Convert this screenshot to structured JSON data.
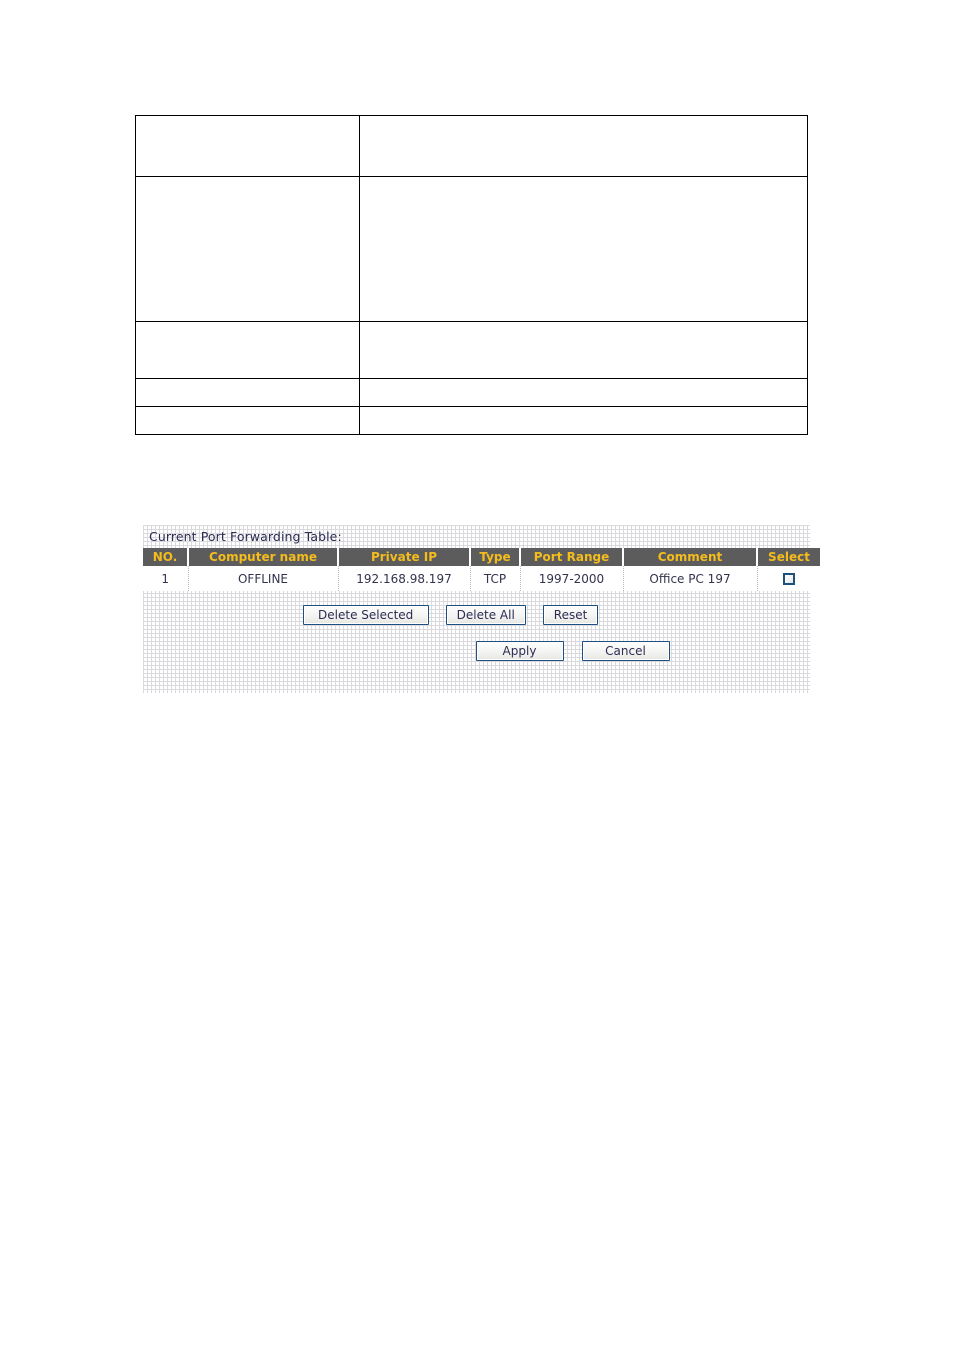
{
  "spec_table": {
    "rows": [
      {
        "label": "",
        "description": ""
      },
      {
        "label": "",
        "description": ""
      },
      {
        "label": "",
        "description": ""
      },
      {
        "label": "",
        "description": ""
      },
      {
        "label": "",
        "description": ""
      }
    ]
  },
  "port_forwarding": {
    "title": "Current Port Forwarding Table:",
    "columns": [
      "NO.",
      "Computer name",
      "Private IP",
      "Type",
      "Port Range",
      "Comment",
      "Select"
    ],
    "rows": [
      {
        "no": "1",
        "computer_name": "OFFLINE",
        "private_ip": "192.168.98.197",
        "type": "TCP",
        "port_range": "1997-2000",
        "comment": "Office PC 197",
        "selected": false
      }
    ],
    "buttons": {
      "delete_selected": "Delete Selected",
      "delete_all": "Delete All",
      "reset": "Reset",
      "apply": "Apply",
      "cancel": "Cancel"
    },
    "colors": {
      "header_background": "#5c5c5c",
      "header_text": "#f4bc1c",
      "body_text": "#33334d",
      "button_border": "#1d4f80",
      "checkbox_border": "#19527f"
    }
  }
}
